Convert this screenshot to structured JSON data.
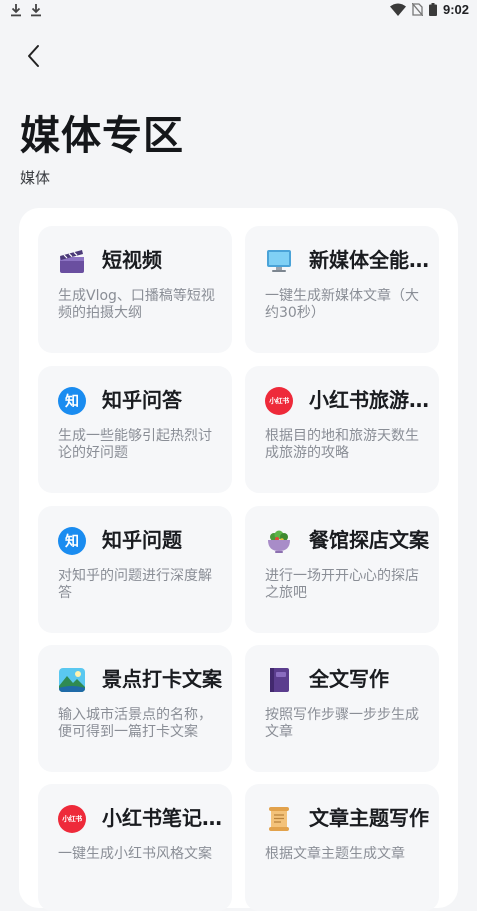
{
  "status_bar": {
    "time": "9:02",
    "left_icons": [
      "download-icon",
      "download-icon"
    ],
    "right_icons": [
      "wifi-icon",
      "no-sim-icon",
      "battery-icon"
    ]
  },
  "header": {
    "back_icon": "chevron-left-icon",
    "title": "媒体专区",
    "subtitle": "媒体"
  },
  "cards": [
    {
      "icon": "clapperboard-icon",
      "title": "短视频",
      "desc": "生成Vlog、口播稿等短视频的拍摄大纲"
    },
    {
      "icon": "monitor-icon",
      "title": "新媒体全能写作",
      "desc": "一键生成新媒体文章（大约30秒）"
    },
    {
      "icon": "zhihu-logo-icon",
      "logo_text": "知",
      "title": "知乎问答",
      "desc": "生成一些能够引起热烈讨论的好问题"
    },
    {
      "icon": "xiaohongshu-logo-icon",
      "logo_text": "小红书",
      "title": "小红书旅游攻略",
      "desc": "根据目的地和旅游天数生成旅游的攻略"
    },
    {
      "icon": "zhihu-logo-icon",
      "logo_text": "知",
      "title": "知乎问题",
      "desc": "对知乎的问题进行深度解答"
    },
    {
      "icon": "salad-bowl-icon",
      "title": "餐馆探店文案",
      "desc": "进行一场开开心心的探店之旅吧"
    },
    {
      "icon": "landscape-icon",
      "title": "景点打卡文案",
      "desc": "输入城市活景点的名称，便可得到一篇打卡文案"
    },
    {
      "icon": "notebook-icon",
      "title": "全文写作",
      "desc": "按照写作步骤一步步生成文章"
    },
    {
      "icon": "xiaohongshu-logo-icon",
      "logo_text": "小红书",
      "title": "小红书笔记文案",
      "desc": "一键生成小红书风格文案"
    },
    {
      "icon": "scroll-icon",
      "title": "文章主题写作",
      "desc": "根据文章主题生成文章"
    }
  ],
  "colors": {
    "background": "#f4f5f7",
    "panel": "#ffffff",
    "card": "#f6f7f9",
    "zhihu_blue": "#1a8cf0",
    "xiaohongshu_red": "#ee2a3a"
  }
}
